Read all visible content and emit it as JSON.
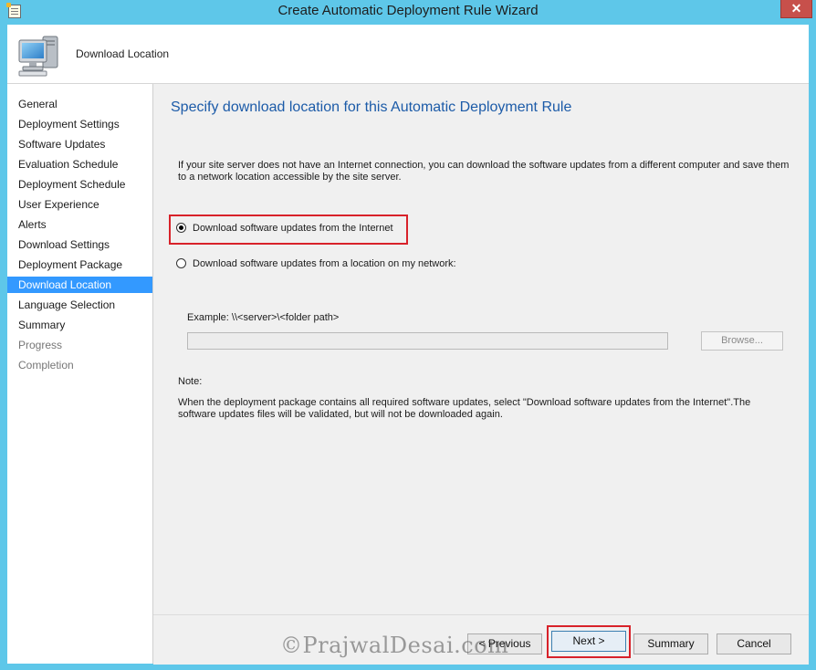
{
  "window": {
    "title": "Create Automatic Deployment Rule Wizard",
    "close_glyph": "✕",
    "icon": "wizard-document-icon"
  },
  "header": {
    "icon": "computer-icon",
    "title": "Download Location"
  },
  "nav": {
    "items": [
      {
        "label": "General",
        "state": "normal"
      },
      {
        "label": "Deployment Settings",
        "state": "normal"
      },
      {
        "label": "Software Updates",
        "state": "normal"
      },
      {
        "label": "Evaluation Schedule",
        "state": "normal"
      },
      {
        "label": "Deployment Schedule",
        "state": "normal"
      },
      {
        "label": "User Experience",
        "state": "normal"
      },
      {
        "label": "Alerts",
        "state": "normal"
      },
      {
        "label": "Download Settings",
        "state": "normal"
      },
      {
        "label": "Deployment Package",
        "state": "normal"
      },
      {
        "label": "Download Location",
        "state": "active"
      },
      {
        "label": "Language Selection",
        "state": "normal"
      },
      {
        "label": "Summary",
        "state": "normal"
      },
      {
        "label": "Progress",
        "state": "disabled"
      },
      {
        "label": "Completion",
        "state": "disabled"
      }
    ]
  },
  "main": {
    "heading": "Specify download location for this Automatic Deployment Rule",
    "description": "If your site server does not have an Internet connection, you can download the software updates from a different computer and save them to a network location accessible by the site server.",
    "option_internet": {
      "label": "Download software updates from the Internet",
      "checked": true
    },
    "option_network": {
      "label": "Download software updates from a location on my network:",
      "checked": false
    },
    "example": "Example: \\\\<server>\\<folder path>",
    "path_value": "",
    "browse_label": "Browse...",
    "note_label": "Note:",
    "note_text": "When the deployment package contains all required software updates, select \"Download  software updates from the Internet\".The software updates files will be validated, but will not be downloaded again."
  },
  "footer": {
    "previous_label": "< Previous",
    "next_label": "Next >",
    "summary_label": "Summary",
    "cancel_label": "Cancel"
  },
  "watermark": "©PrajwalDesai.com",
  "colors": {
    "accent": "#3399ff",
    "heading": "#1c5ba8",
    "highlight": "#d8222a",
    "frame": "#5ec7e9"
  }
}
